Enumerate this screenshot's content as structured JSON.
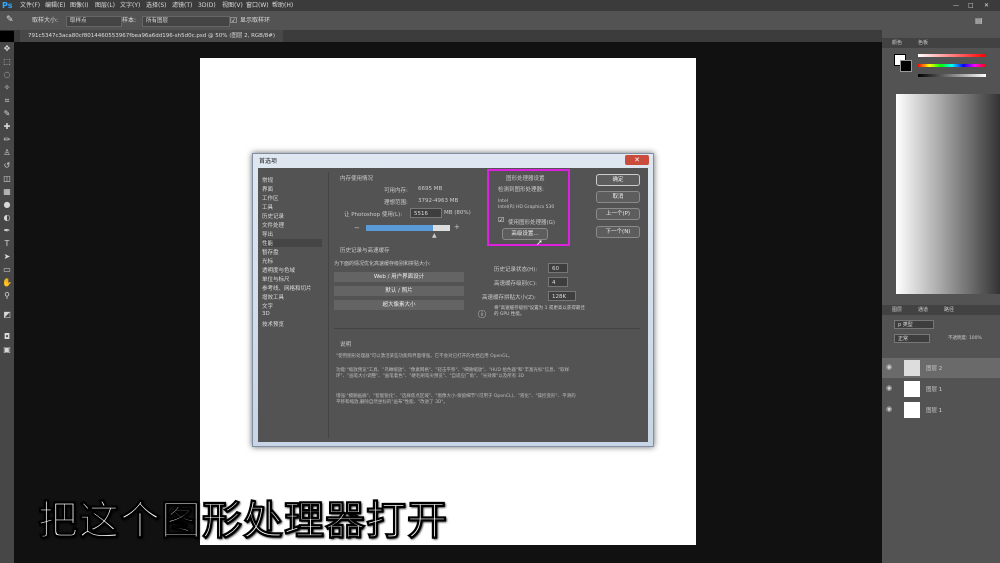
{
  "menubar": {
    "logo": "Ps",
    "items": [
      "文件(F)",
      "编辑(E)",
      "图像(I)",
      "图层(L)",
      "文字(Y)",
      "选择(S)",
      "滤镜(T)",
      "3D(D)",
      "视图(V)",
      "窗口(W)",
      "帮助(H)"
    ]
  },
  "options": {
    "sample_size_label": "取样大小:",
    "sample_size_value": "取样点",
    "sample_label": "样本:",
    "sample_value": "所有图层",
    "show_ring": "显示取样环"
  },
  "doc_tab": "791c5347c3aca80cf8014460553967fbea96a6dd196-sh5d0c.psd @ 50% (图层 2, RGB/8#)",
  "right_panels": {
    "color_tabs": [
      "颜色",
      "色板"
    ],
    "layer_tabs": [
      "图层",
      "通道",
      "路径"
    ],
    "search_placeholder": "p 类型",
    "blend": "正常",
    "opacity": "不透明度: 100%",
    "layers": [
      "图层 2",
      "图层 1",
      "图层 1"
    ]
  },
  "dialog": {
    "title": "首选项",
    "nav": [
      "常规",
      "界面",
      "工作区",
      "工具",
      "历史记录",
      "文件处理",
      "导出",
      "性能",
      "暂存盘",
      "光标",
      "透明度与色域",
      "单位与标尺",
      "参考线、网格和切片",
      "增效工具",
      "文字",
      "3D",
      "技术预览"
    ],
    "selected_nav": "性能",
    "memory": {
      "header": "内存使用情况",
      "available_label": "可用内存:",
      "available_value": "6695 MB",
      "ideal_label": "理想范围:",
      "ideal_value": "3792-4963 MB",
      "use_label": "让 Photoshop 使用(L):",
      "use_value": "5516",
      "use_mb": "MB (80%)",
      "minus": "−",
      "plus": "+",
      "fill_fraction": 0.8
    },
    "gpu": {
      "header": "图形处理器设置",
      "detected_label": "检测到图形处理器:",
      "vendor": "Intel",
      "model": "Intel(R) HD Graphics 530",
      "checkbox_label": "使用图形处理器(G)",
      "checked": true,
      "advanced_button": "高级设置..."
    },
    "buttons": [
      "确定",
      "取消",
      "上一个(P)",
      "下一个(N)"
    ],
    "history": {
      "header": "历史记录与高速缓存",
      "hint": "为下面的情况优化高速缓存级别和拼贴大小:",
      "presets": [
        "Web / 用户界面设计",
        "默认 / 照片",
        "超大像素大小"
      ],
      "history_states_label": "历史记录状态(H):",
      "history_states_value": "60",
      "cache_levels_label": "高速缓存级别(C):",
      "cache_levels_value": "4",
      "tile_size_label": "高速缓存拼贴大小(Z):",
      "tile_size_value": "128K",
      "cache_note": "将\"高速缓存级别\"设置为 1 或更高以获得最佳的 GPU 性能。"
    },
    "description": {
      "header": "说明",
      "text1": "\"使用图形处理器\"可以激活某些功能和界面增强。它不会对已打开的文档启用 OpenGL。",
      "text2": "功能:\"缩放预览\"工具、\"鸟瞰缩放\"、\"像素网格\"、\"轻击平移\"、\"细微缩放\"、\"HUD 拾色器\"和\"丰富光标\"信息、\"取样环\"、\"画笔大小调整\"、\"画笔着色\"、\"硬毛刷笔尖预览\"、\"自适应广角\"、\"光效库\"以及所有 3D",
      "text3": "增强:\"模糊画廊\"、\"智能锐化\"、\"选择焦点区域\"、\"图像大小-保留细节\"(可用于 OpenCL)、\"液化\"、\"操控变形\"、平滑的平移和缩放,删除自然坐标的\"画布\"性能、\"改进了 3D\"。"
    }
  },
  "caption": "把这个图形处理器打开",
  "colors": {
    "highlight": "#e020e0",
    "accent_blue": "#5b9ad8"
  }
}
